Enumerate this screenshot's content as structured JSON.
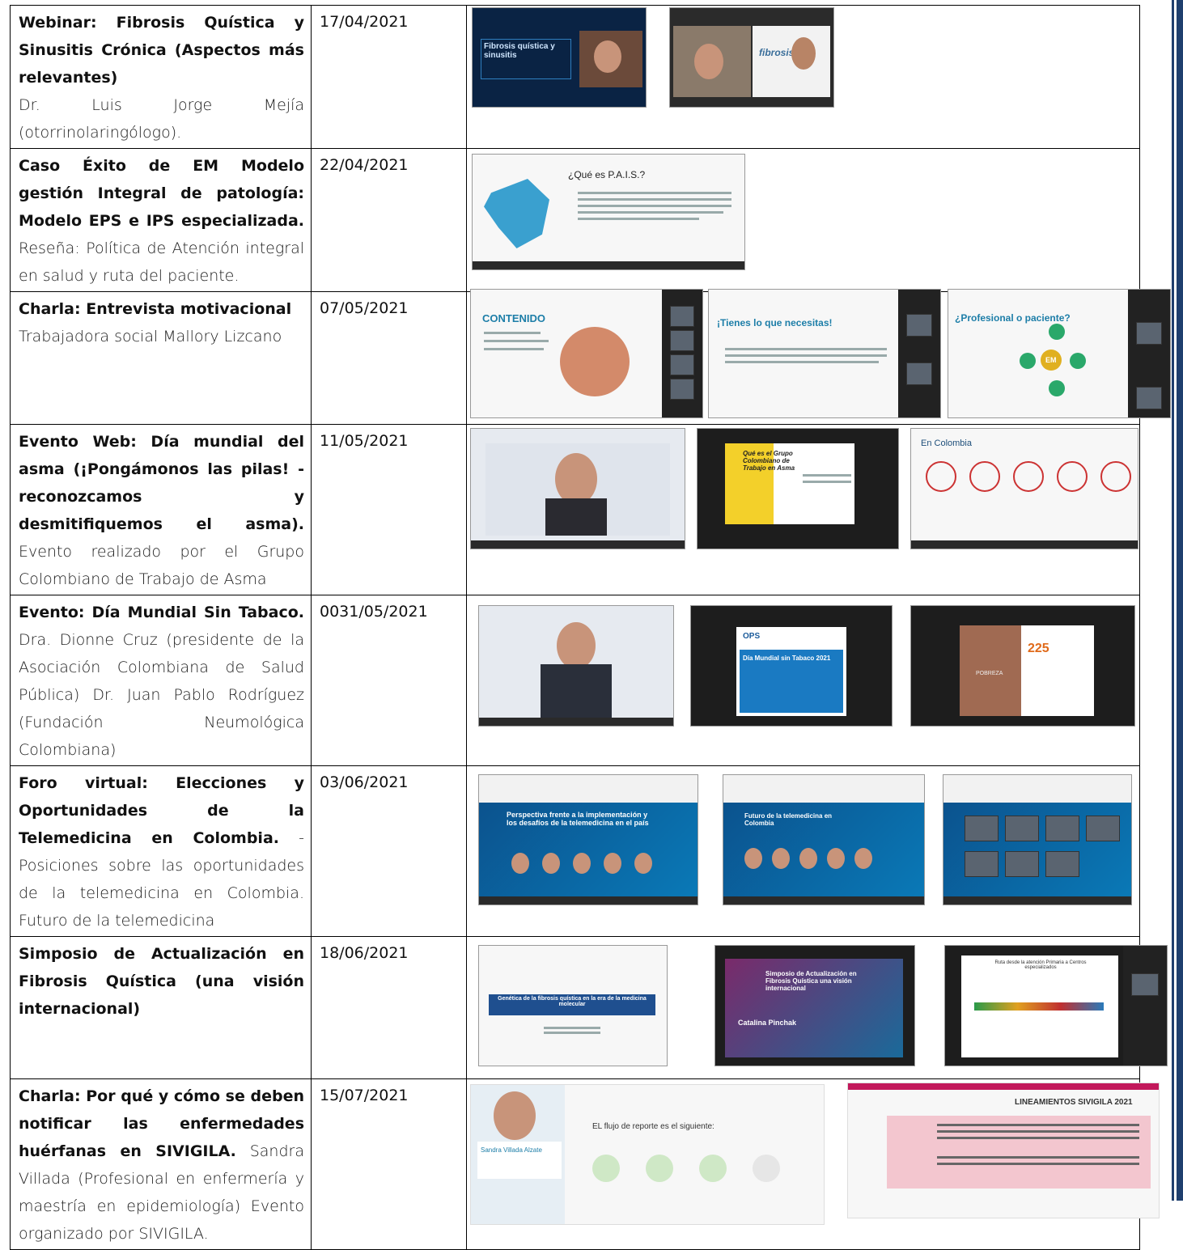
{
  "rows": [
    {
      "title": "Webinar: Fibrosis Quística y Sinusitis Crónica (Aspectos más relevantes)",
      "detail": "Dr. Luis Jorge Mejía (otorrinolaringólogo).",
      "date": "17/04/2021",
      "thumbs": [
        "Fibrosis quística y sinusitis",
        "fibrosis"
      ]
    },
    {
      "title": "Caso Éxito de EM Modelo gestión Integral de patología: Modelo EPS e IPS especializada.",
      "detail": "Reseña: Política de Atención integral en salud y ruta del paciente.",
      "date": "22/04/2021",
      "thumbs": [
        "¿Qué es P.A.I.S.?"
      ]
    },
    {
      "title": "Charla: Entrevista motivacional",
      "detail": "Trabajadora social Mallory Lizcano",
      "date": "07/05/2021",
      "thumbs": [
        "CONTENIDO",
        "¡Tienes lo que necesitas!",
        "¿Profesional o paciente?",
        "EM"
      ]
    },
    {
      "title": "Evento Web: Día mundial del asma (¡Pongámonos las pilas! - reconozcamos y desmitifiquemos el asma).",
      "detail": "Evento realizado por el Grupo Colombiano de Trabajo de Asma",
      "date": "11/05/2021",
      "thumbs": [
        "Qué es el Grupo Colombiano de Trabajo en Asma",
        "En Colombia"
      ]
    },
    {
      "title": "Evento: Día Mundial Sin Tabaco.",
      "detail": "Dra. Dionne Cruz (presidente de la Asociación Colombiana de Salud Pública) Dr. Juan Pablo Rodríguez (Fundación Neumológica Colombiana)",
      "date": "0031/05/2021",
      "thumbs": [
        "OPS",
        "Día Mundial sin Tabaco 2021",
        "POBREZA",
        "225"
      ]
    },
    {
      "title": "Foro virtual: Elecciones y Oportunidades de la Telemedicina en Colombia.",
      "detail": "-Posiciones sobre las oportunidades de la telemedicina en Colombia. Futuro de la telemedicina",
      "date": "03/06/2021",
      "thumbs": [
        "Perspectiva frente a la implementación y los desafíos de la telemedicina en el país",
        "Futuro de la telemedicina en Colombia"
      ]
    },
    {
      "title": "Simposio de Actualización en Fibrosis Quística (una visión internacional)",
      "detail": "",
      "date": "18/06/2021",
      "thumbs": [
        "Genética de la fibrosis quística en la era de la medicina molecular",
        "Simposio de Actualización en Fibrosis Quística una visión internacional",
        "Catalina Pinchak",
        "Ruta desde la atención Primaria a Centros especializados"
      ]
    },
    {
      "title": "Charla: Por qué y cómo se deben notificar las enfermedades huérfanas en SIVIGILA.",
      "detail": "Sandra Villada (Profesional en enfermería y maestría en epidemiología) Evento organizado por SIVIGILA.",
      "date": "15/07/2021",
      "thumbs": [
        "EL flujo de reporte es el siguiente:",
        "Sandra Villada Alzate",
        "LINEAMIENTOS SIVIGILA 2021"
      ]
    }
  ]
}
